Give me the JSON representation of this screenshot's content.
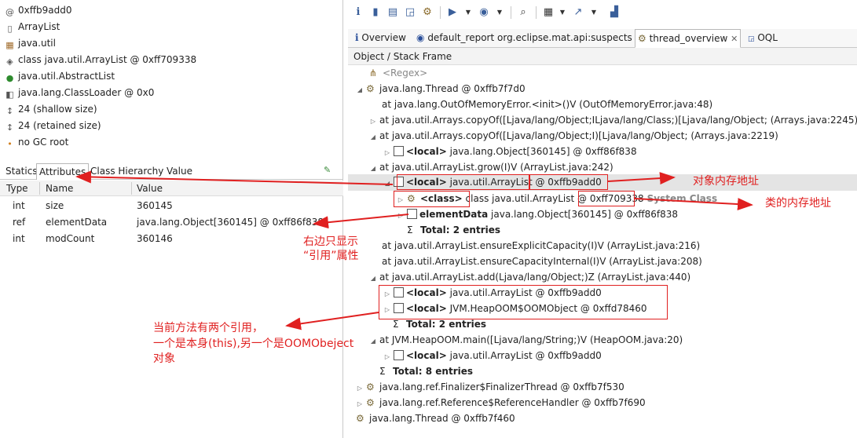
{
  "left_panel": {
    "lines": [
      {
        "icon": "at-icon",
        "glyph": "@",
        "text": "0xffb9add0"
      },
      {
        "icon": "file-icon",
        "glyph": "▯",
        "text": "ArrayList"
      },
      {
        "icon": "package-icon",
        "glyph": "▦",
        "text": "java.util"
      },
      {
        "icon": "class-icon",
        "glyph": "◈",
        "text": "class java.util.ArrayList @ 0xff709338"
      },
      {
        "icon": "superclass-icon",
        "glyph": "●",
        "text": "java.util.AbstractList"
      },
      {
        "icon": "classloader-icon",
        "glyph": "◧",
        "text": "java.lang.ClassLoader @ 0x0"
      },
      {
        "icon": "size-icon",
        "glyph": "↕",
        "text": "24 (shallow size)"
      },
      {
        "icon": "size-icon",
        "glyph": "↕",
        "text": "24 (retained size)"
      },
      {
        "icon": "gc-root-icon",
        "glyph": "•",
        "text": "no GC root"
      }
    ],
    "tabs": [
      "Statics",
      "Attributes",
      "Class Hierarchy",
      "Value"
    ],
    "table": {
      "headers": [
        "Type",
        "Name",
        "Value"
      ],
      "rows": [
        [
          "int",
          "size",
          "360145"
        ],
        [
          "ref",
          "elementData",
          "java.lang.Object[360145] @ 0xff86f838"
        ],
        [
          "int",
          "modCount",
          "360146"
        ]
      ]
    }
  },
  "editor_tabs": [
    "Overview",
    "default_report  org.eclipse.mat.api:suspects",
    "thread_overview",
    "OQL"
  ],
  "column_header": "Object / Stack Frame",
  "tree": {
    "regex": "<Regex>",
    "thread1": "java.lang.Thread @ 0xffb7f7d0",
    "f1": "at java.lang.OutOfMemoryError.<init>()V (OutOfMemoryError.java:48)",
    "f2": "at java.util.Arrays.copyOf([Ljava/lang/Object;ILjava/lang/Class;)[Ljava/lang/Object; (Arrays.java:2245)",
    "f3": "at java.util.Arrays.copyOf([Ljava/lang/Object;I)[Ljava/lang/Object; (Arrays.java:2219)",
    "f3_local_tag": "<local>",
    "f3_local": " java.lang.Object[360145] @ 0xff86f838",
    "f4": "at java.util.ArrayList.grow(I)V (ArrayList.java:242)",
    "f4_local_tag": "<local>",
    "f4_local": " java.util.ArrayList @ 0xffb9add0",
    "class_tag": "<class>",
    "class_text": " class java.util.ArrayList @ 0xff709338",
    "system_class": "System Class",
    "elementdata_tag": "elementData",
    "elementdata_text": " java.lang.Object[360145] @ 0xff86f838",
    "total_a": "Total: 2 entries",
    "f5": "at java.util.ArrayList.ensureExplicitCapacity(I)V (ArrayList.java:216)",
    "f6": "at java.util.ArrayList.ensureCapacityInternal(I)V (ArrayList.java:208)",
    "f7": "at java.util.ArrayList.add(Ljava/lang/Object;)Z (ArrayList.java:440)",
    "f7_local1_tag": "<local>",
    "f7_local1": " java.util.ArrayList @ 0xffb9add0",
    "f7_local2_tag": "<local>",
    "f7_local2": " JVM.HeapOOM$OOMObject @ 0xffd78460",
    "total_b": "Total: 2 entries",
    "f8": "at JVM.HeapOOM.main([Ljava/lang/String;)V (HeapOOM.java:20)",
    "f8_local_tag": "<local>",
    "f8_local": " java.util.ArrayList @ 0xffb9add0",
    "total_c": "Total: 8 entries",
    "thread2": "java.lang.ref.Finalizer$FinalizerThread @ 0xffb7f530",
    "thread3": "java.lang.ref.Reference$ReferenceHandler @ 0xffb7f690",
    "thread4": "java.lang.Thread @ 0xffb7f460"
  },
  "annotations": {
    "obj_addr": "对象内存地址",
    "class_addr": "类的内存地址",
    "right_refs_1": "右边只显示",
    "right_refs_2": "“引用”属性",
    "two_refs_1": "当前方法有两个引用，",
    "two_refs_2": "一个是本身(this),另一个是OOMObeject",
    "two_refs_3": "对象"
  },
  "colors": {
    "annotation": "#e02020",
    "selection": "#e4e4e4"
  }
}
